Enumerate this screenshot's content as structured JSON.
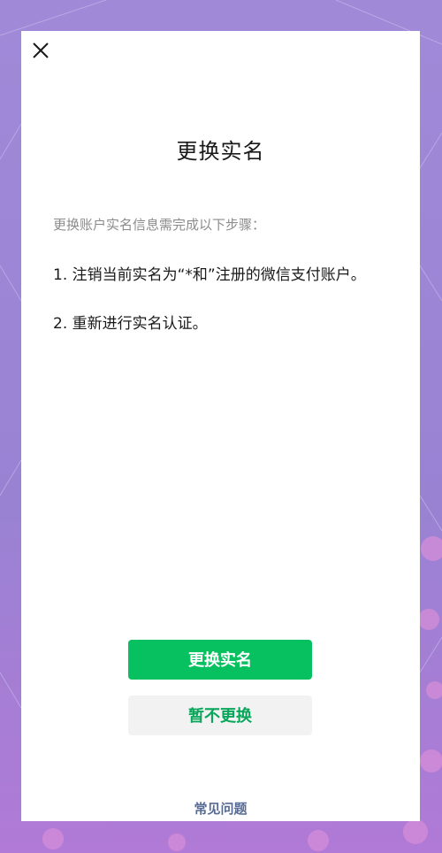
{
  "dialog": {
    "close_icon": "close-icon",
    "title": "更换实名",
    "intro": "更换账户实名信息需完成以下步骤：",
    "steps": [
      "1. 注销当前实名为“*和”注册的微信支付账户。",
      "2. 重新进行实名认证。"
    ],
    "primary_button": "更换实名",
    "secondary_button": "暂不更换",
    "faq_link": "常见问题"
  },
  "colors": {
    "background": "#9b84d4",
    "primary": "#07c160",
    "secondary_bg": "#f2f2f2",
    "secondary_text": "#07a65a",
    "link": "#576b95"
  }
}
